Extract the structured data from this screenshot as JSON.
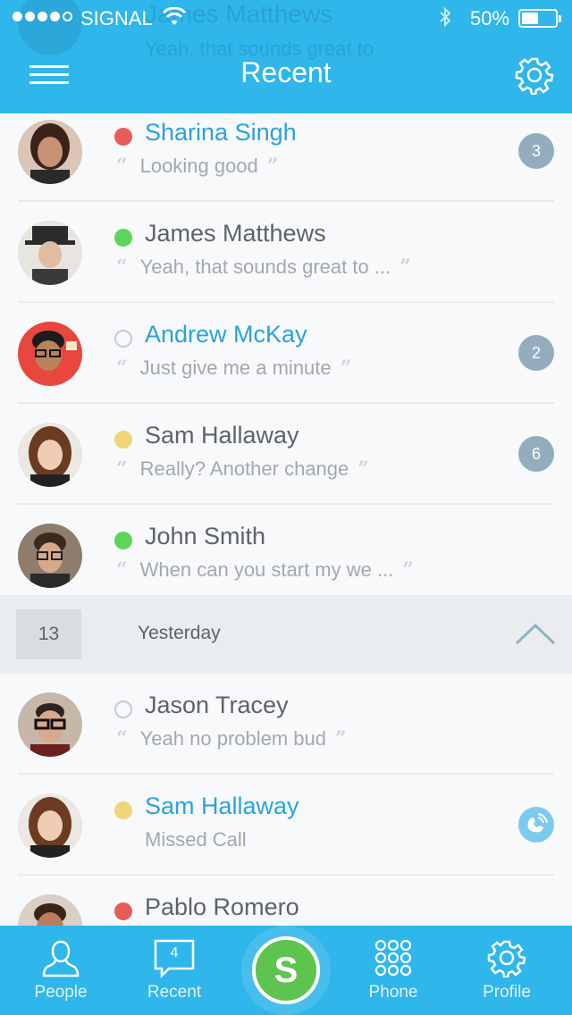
{
  "statusbar": {
    "carrier": "SIGNAL",
    "battery": "50%",
    "battery_level": 0.5
  },
  "header": {
    "title": "Recent",
    "ghost_name": "James Matthews",
    "ghost_msg": "Yeah, that sounds great to"
  },
  "rows": [
    {
      "name": "Sharina Singh",
      "message": "Looking good",
      "presence": "busy",
      "highlight": true,
      "badge": "3"
    },
    {
      "name": "James Matthews",
      "message": "Yeah, that sounds great to ...",
      "presence": "online",
      "highlight": false,
      "badge": ""
    },
    {
      "name": "Andrew McKay",
      "message": "Just give me a minute",
      "presence": "offline",
      "highlight": true,
      "badge": "2"
    },
    {
      "name": "Sam Hallaway",
      "message": "Really? Another change",
      "presence": "away",
      "highlight": false,
      "badge": "6"
    },
    {
      "name": "John Smith",
      "message": "When can you start my we ...",
      "presence": "online",
      "highlight": false,
      "badge": ""
    }
  ],
  "section": {
    "count": "13",
    "label": "Yesterday"
  },
  "rows2": [
    {
      "name": "Jason Tracey",
      "message": "Yeah no problem bud",
      "presence": "offline",
      "highlight": false
    },
    {
      "name": "Sam Hallaway",
      "message": "Missed Call",
      "presence": "away",
      "highlight": true,
      "missed_call": true
    },
    {
      "name": "Pablo Romero",
      "message": "",
      "presence": "busy",
      "highlight": false
    }
  ],
  "tabs": {
    "people": "People",
    "recent": "Recent",
    "recent_count": "4",
    "skype_letter": "S",
    "phone": "Phone",
    "profile": "Profile"
  },
  "colors": {
    "accent": "#2fb6ea",
    "online": "#5fd45a",
    "busy": "#e85b5b",
    "away": "#f1d47a",
    "skype": "#5cc44f"
  }
}
